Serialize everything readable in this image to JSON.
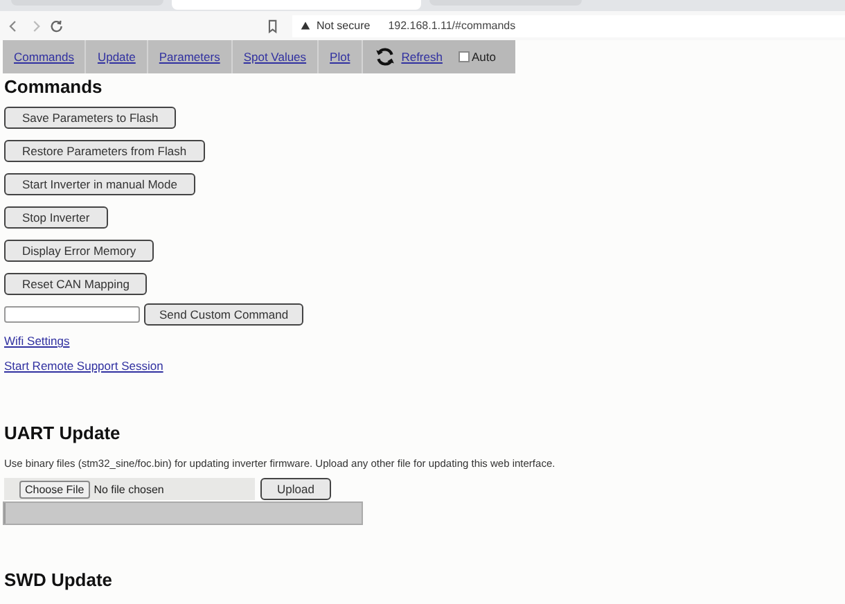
{
  "browser": {
    "tabs": [
      {
        "selected": false
      },
      {
        "selected": true
      },
      {
        "selected": false
      }
    ],
    "security": "Not secure",
    "url": "192.168.1.11/#commands"
  },
  "nav": {
    "items": [
      {
        "label": "Commands"
      },
      {
        "label": "Update"
      },
      {
        "label": "Parameters"
      },
      {
        "label": "Spot Values"
      },
      {
        "label": "Plot"
      }
    ],
    "refresh": "Refresh",
    "auto": {
      "label": "Auto",
      "checked": false
    }
  },
  "commands": {
    "title": "Commands",
    "buttons": [
      "Save Parameters to Flash",
      "Restore Parameters from Flash",
      "Start Inverter in manual Mode",
      "Stop Inverter",
      "Display Error Memory",
      "Reset CAN Mapping"
    ],
    "custom_button": "Send Custom Command",
    "links": [
      "Wifi Settings",
      "Start Remote Support Session"
    ]
  },
  "uart": {
    "title": "UART Update",
    "description": "Use binary files (stm32_sine/foc.bin) for updating inverter firmware. Upload any other file for updating this web interface.",
    "choose": "Choose File",
    "no_file": "No file chosen",
    "upload": "Upload",
    "progress": {
      "level": 0
    }
  },
  "swd": {
    "title": "SWD Update"
  }
}
